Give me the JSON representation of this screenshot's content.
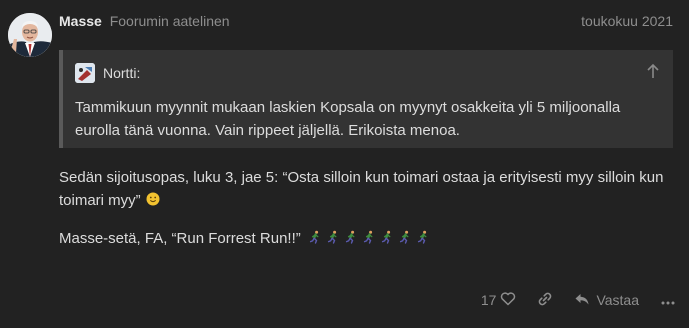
{
  "post": {
    "username": "Masse",
    "user_title": "Foorumin aatelinen",
    "date": "toukokuu 2021",
    "quote": {
      "author": "Nortti:",
      "text": "Tammikuun myynnit mukaan laskien Kopsala on myynyt osakkeita yli 5 miljoonalla eurolla tänä vuonna. Vain rippeet jäljellä. Erikoista menoa."
    },
    "paragraphs": [
      "Sedän sijoitusopas, luku 3, jae 5: “Osta silloin kun toimari ostaa ja erityisesti myy silloin kun toimari myy”",
      "Masse-setä, FA, “Run Forrest Run!!”"
    ],
    "emojis": {
      "p1": "slightly-smiling-face",
      "p2": "running-man",
      "p2_count": 7
    }
  },
  "actions": {
    "likes_count": "17",
    "reply_label": "Vastaa"
  }
}
